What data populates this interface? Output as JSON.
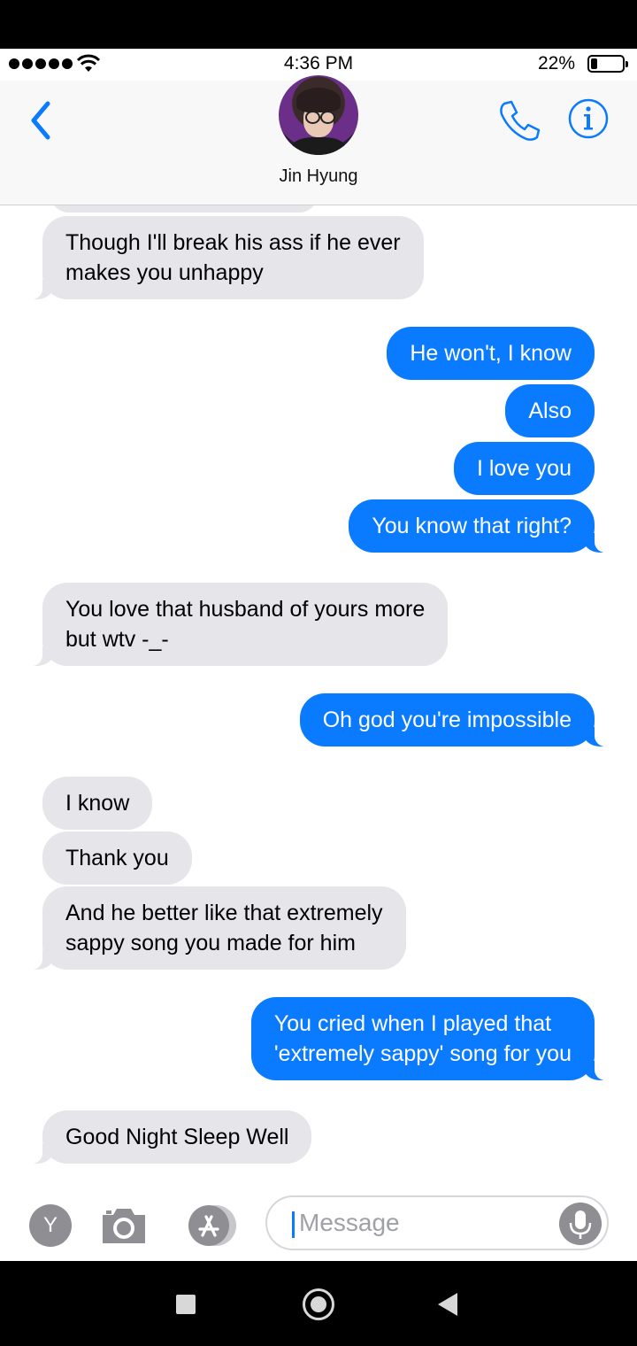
{
  "status_bar": {
    "time": "4:36 PM",
    "battery_percent": "22%",
    "battery_level": 0.22,
    "signal_bars": 5
  },
  "header": {
    "contact_name": "Jin Hyung",
    "back_icon": "chevron-left-icon",
    "call_icon": "phone-icon",
    "info_icon": "info-icon"
  },
  "messages": [
    {
      "from": "contact",
      "text": "Though I'll break his ass if he ever\nmakes you unhappy"
    },
    {
      "from": "me",
      "text": "He won't, I know"
    },
    {
      "from": "me",
      "text": "Also"
    },
    {
      "from": "me",
      "text": "I love you"
    },
    {
      "from": "me",
      "text": "You know that right?"
    },
    {
      "from": "contact",
      "text": "You love that husband of yours more\nbut wtv -_-"
    },
    {
      "from": "me",
      "text": "Oh god you're impossible"
    },
    {
      "from": "contact",
      "text": "I know"
    },
    {
      "from": "contact",
      "text": "Thank you"
    },
    {
      "from": "contact",
      "text": "And he better like that extremely\nsappy song you made for him"
    },
    {
      "from": "me",
      "text": "You cried when I played that\n'extremely sappy' song for you"
    },
    {
      "from": "contact",
      "text": "Good Night Sleep Well"
    }
  ],
  "composer": {
    "app_badge": "Y",
    "placeholder": "Message",
    "camera_icon": "camera-icon",
    "appstore_icon": "app-store-icon",
    "mic_icon": "microphone-icon"
  },
  "colors": {
    "outgoing": "#0a7aff",
    "incoming": "#e5e5ea",
    "accent": "#0a7aff"
  }
}
